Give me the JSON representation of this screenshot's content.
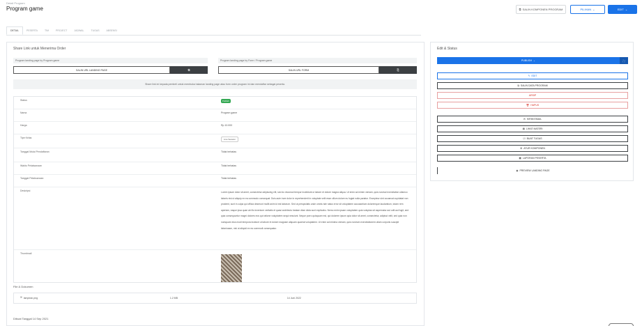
{
  "header": {
    "breadcrumb": "Detail Program",
    "title": "Program game",
    "buttons": [
      {
        "label": "SALIN KOMPONEN PROGRAM",
        "icon": "copy-icon"
      },
      {
        "label": "PILIHAN",
        "icon": "chevron-down-icon"
      },
      {
        "label": "EDIT",
        "icon": "chevron-down-icon"
      }
    ]
  },
  "tabs": [
    "DETAIL",
    "PESERTA",
    "TIM",
    "PROJECT",
    "JADWAL",
    "TUGAS",
    "ABSENSI"
  ],
  "left_card": {
    "title": "Share Link untuk Menerima Order",
    "share": [
      {
        "label": "Program landing page by Program game",
        "value": "SALIN URL LANDING PAGE",
        "copy": "⧉"
      },
      {
        "label": "Program landing page by Form / Program game",
        "value": "SALIN URL FORM",
        "copy": "⎘"
      }
    ],
    "note": "Share link ini kepada pembeli untuk membuka halaman landing page atau form order program ini dan mendaftar sebagai peserta.",
    "rows": [
      {
        "key": "Status",
        "badge": "Publish"
      },
      {
        "key": "Nama",
        "value": "Program game"
      },
      {
        "key": "Harga",
        "value": "Rp 10.000"
      },
      {
        "key": "Tipe Kelas",
        "pill": "Live Session"
      },
      {
        "key": "Tanggal Mulai Pendaftaran",
        "value": "Tidak terbatas"
      },
      {
        "key": "Waktu Pelaksanaan",
        "value": "Tidak terbatas"
      },
      {
        "key": "Tanggal Pelaksanaan",
        "value": "Tidak terbatas"
      },
      {
        "key": "Deskripsi",
        "value": "Lorem ipsum dolor sit amet, consectetur adipiscing elit, sed do eiusmod tempor incididunt ut labore et dolore magna aliqua. Ut enim ad minim veniam, quis nostrud exercitation ullamco laboris nisi ut aliquip ex ea commodo consequat. Duis aute irure dolor in reprehenderit in voluptate velit esse cillum dolore eu fugiat nulla pariatur. Excepteur sint occaecat cupidatat non proident, sunt in culpa qui officia deserunt mollit anim id est laborum. Sed ut perspiciatis unde omnis iste natus error sit voluptatem accusantium doloremque laudantium, totam rem aperiam, eaque ipsa quae ab illo inventore veritatis et quasi architecto beatae vitae dicta sunt explicabo. Nemo enim ipsam voluptatem quia voluptas sit aspernatur aut odit aut fugit, sed quia consequuntur magni dolores eos qui ratione voluptatem sequi nesciunt. Neque porro quisquam est, qui dolorem ipsum quia dolor sit amet, consectetur, adipisci velit, sed quia non numquam eius modi tempora incidunt ut labore et dolore magnam aliquam quaerat voluptatem. Ut enim ad minima veniam, quis nostrum exercitationem ullam corporis suscipit laboriosam, nisi ut aliquid ex ea commodi consequatur."
      },
      {
        "key": "Thumbnail"
      }
    ],
    "files_title": "File & Dokumen",
    "file": {
      "name": "lampiran.png",
      "size": "1.2 MB",
      "date": "14 Juni 2022"
    },
    "footer": "Dibuat Tanggal 14 Sep 2021"
  },
  "right_card": {
    "title": "Edit & Status",
    "status": {
      "label": "PUBLISH",
      "side": "⛶"
    },
    "actions": [
      {
        "label": "EDIT",
        "icon": "edit-icon",
        "style": "blue"
      },
      {
        "label": "SALIN DATA PROGRAM",
        "icon": "copy-icon",
        "style": "dark"
      },
      {
        "label": "ARSIP",
        "icon": "",
        "style": "red"
      },
      {
        "label": "HAPUS",
        "icon": "trash-icon",
        "style": "red"
      },
      {
        "label": "KIRIM EMAIL",
        "icon": "mail-icon",
        "style": "dark"
      },
      {
        "label": "LIHAT MATERI",
        "icon": "book-icon",
        "style": "dark"
      },
      {
        "label": "BUAT TUGAS",
        "icon": "task-icon",
        "style": "dark"
      },
      {
        "label": "ATUR KOMPONEN",
        "icon": "settings-icon",
        "style": "dark"
      },
      {
        "label": "LAPORAN PESERTA",
        "icon": "report-icon",
        "style": "dark"
      },
      {
        "label": "PREVIEW LANDING PAGE",
        "icon": "eye-icon",
        "style": "plain"
      }
    ]
  }
}
